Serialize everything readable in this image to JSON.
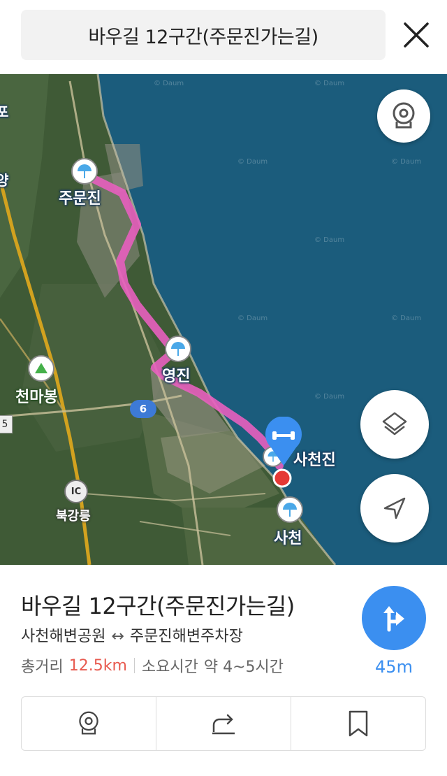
{
  "header": {
    "title": "바우길 12구간(주문진가는길)",
    "close_icon": "close-icon"
  },
  "map": {
    "watermark": "© Daum",
    "pois": {
      "jumunjin": "주문진",
      "yeongjin": "영진",
      "sacheonjin": "사천진",
      "sacheon": "사천",
      "cheonmabong": "천마봉",
      "bukgangneung": "북강릉",
      "ic": "IC"
    },
    "road_badge": "6",
    "road_number_left": "5",
    "road_fragment_top": "양",
    "road_fragment_top2": "포",
    "route_color": "#e85fbf",
    "fab_icons": [
      "roadview-icon",
      "layers-icon",
      "location-arrow-icon"
    ]
  },
  "info": {
    "title": "바우길 12구간(주문진가는길)",
    "start": "사천해변공원",
    "arrow": "↔",
    "end": "주문진해변주차장",
    "distance_label": "총거리",
    "distance_value": "12.5km",
    "time_label": "소요시간",
    "time_value": "약 4~5시간",
    "nav_distance": "45m",
    "accent": "#3b8ff0",
    "distance_color": "#e85a4f"
  },
  "actions": [
    {
      "icon": "roadview-icon"
    },
    {
      "icon": "share-icon"
    },
    {
      "icon": "bookmark-icon"
    }
  ]
}
